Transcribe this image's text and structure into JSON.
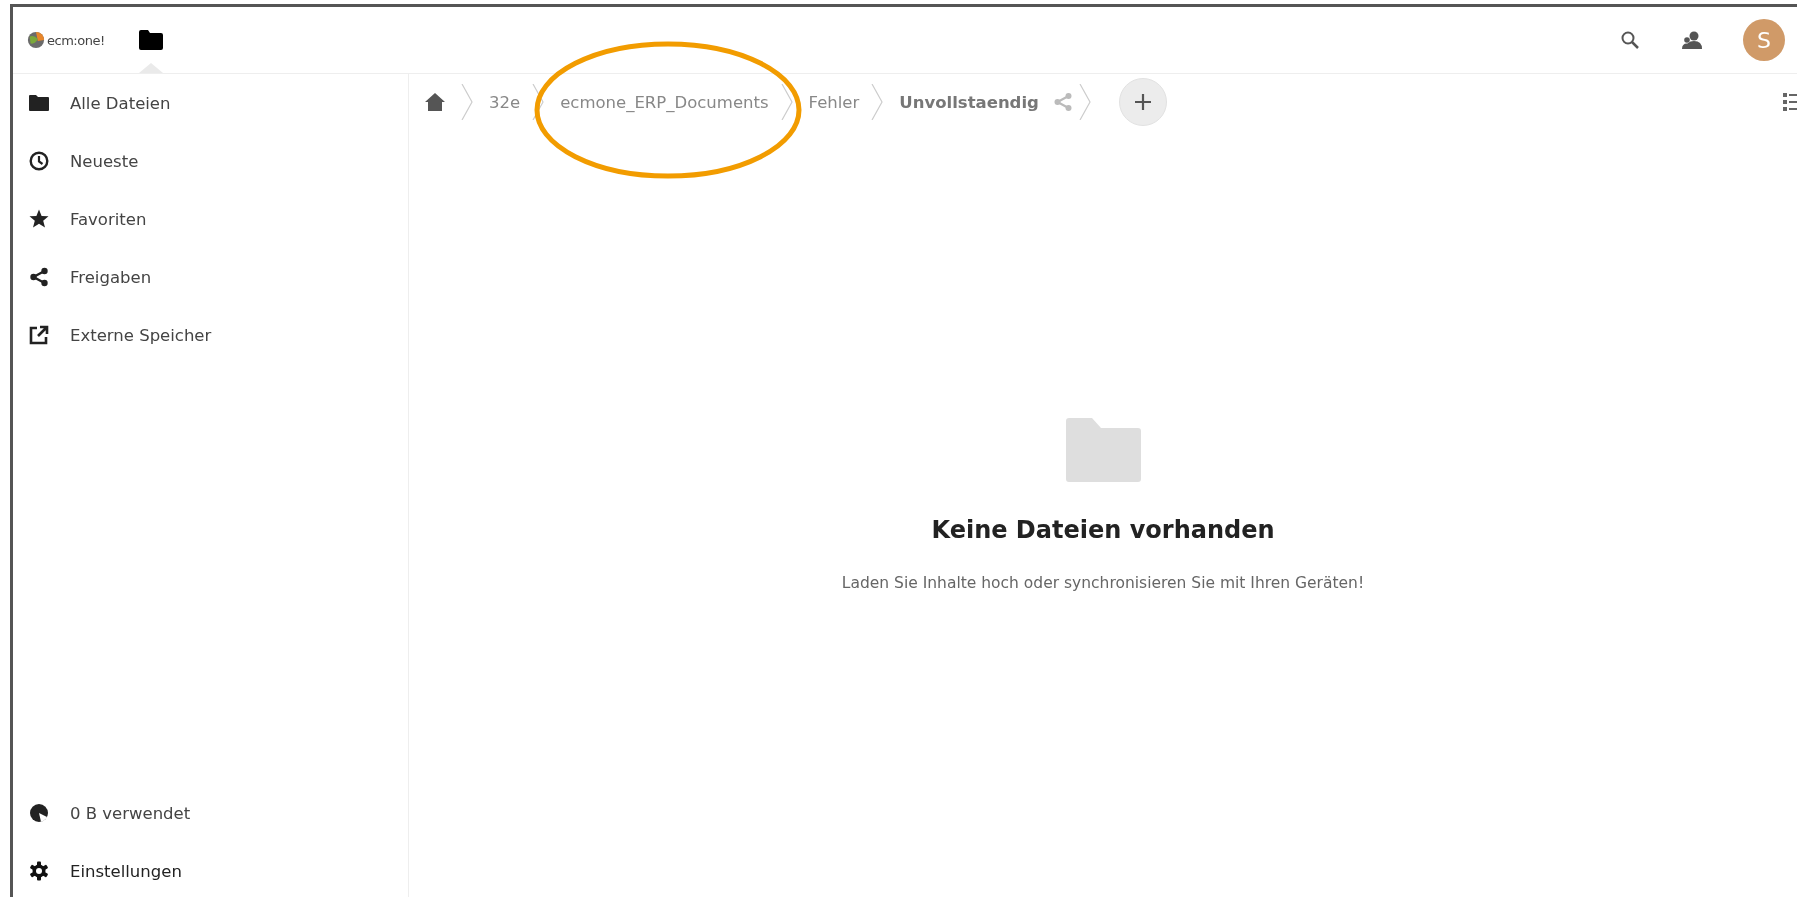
{
  "header": {
    "logo": "ecm:one!",
    "avatar": "S"
  },
  "sidebar": {
    "items": [
      {
        "label": "Alle Dateien"
      },
      {
        "label": "Neueste"
      },
      {
        "label": "Favoriten"
      },
      {
        "label": "Freigaben"
      },
      {
        "label": "Externe Speicher"
      }
    ],
    "quota": "0 B verwendet",
    "settings": "Einstellungen"
  },
  "breadcrumbs": [
    {
      "label": "32e",
      "current": false
    },
    {
      "label": "ecmone_ERP_Documents",
      "current": false
    },
    {
      "label": "Fehler",
      "current": false
    },
    {
      "label": "Unvollstaendig",
      "current": true
    }
  ],
  "empty": {
    "title": "Keine Dateien vorhanden",
    "message": "Laden Sie Inhalte hoch oder synchronisieren Sie mit Ihren Geräten!"
  }
}
